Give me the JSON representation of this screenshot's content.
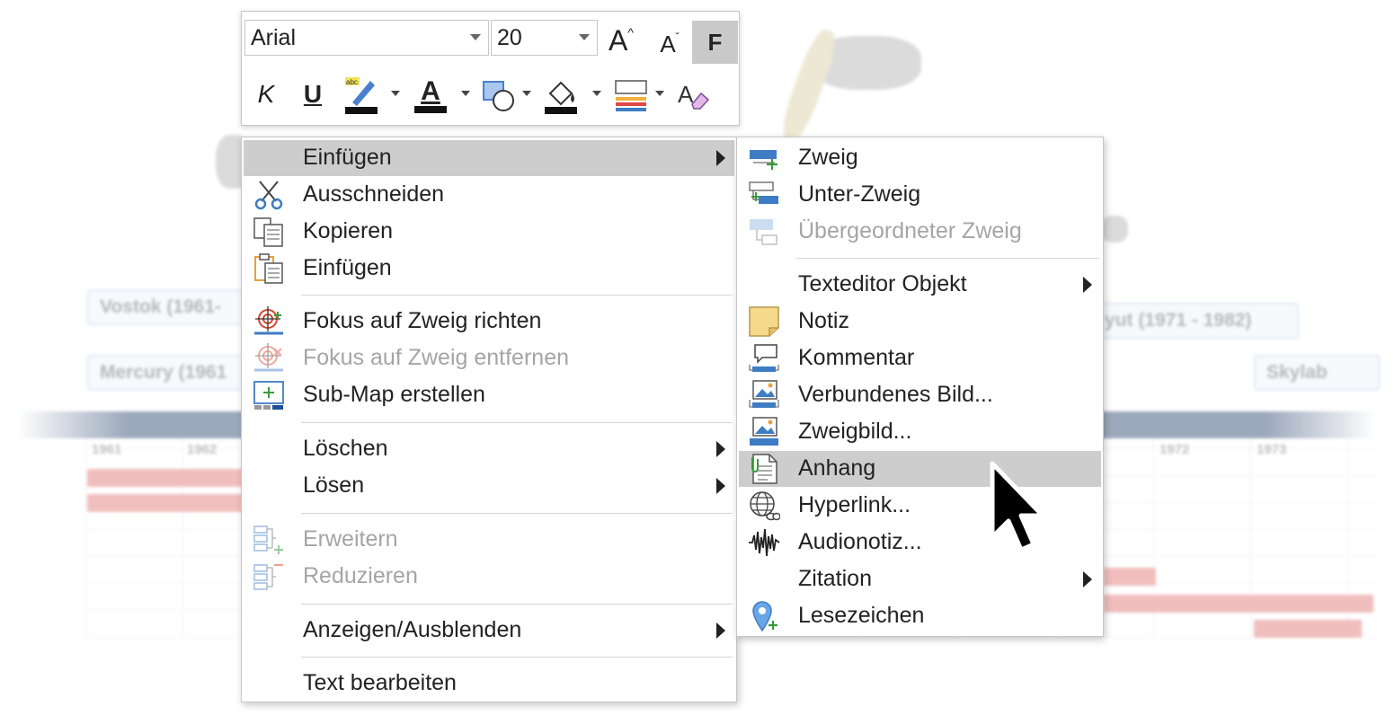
{
  "toolbar": {
    "font_name": "Arial",
    "font_size": "20",
    "grow_label": "A",
    "shrink_label": "A",
    "bold_label": "F",
    "italic_label": "K",
    "underline_label": "U",
    "font_color_label": "A",
    "clear_label": "A"
  },
  "context_menu": {
    "items": [
      {
        "label": "Einfügen",
        "icon": "none",
        "submenu": true,
        "highlighted": true,
        "disabled": false
      },
      {
        "label": "Ausschneiden",
        "icon": "scissors-icon",
        "submenu": false,
        "disabled": false
      },
      {
        "label": "Kopieren",
        "icon": "copy-icon",
        "submenu": false,
        "disabled": false
      },
      {
        "label": "Einfügen",
        "icon": "paste-icon",
        "submenu": false,
        "disabled": false
      },
      {
        "label": "Fokus auf Zweig richten",
        "icon": "focus-target-icon",
        "submenu": false,
        "disabled": false
      },
      {
        "label": "Fokus auf Zweig entfernen",
        "icon": "focus-remove-icon",
        "submenu": false,
        "disabled": true
      },
      {
        "label": "Sub-Map erstellen",
        "icon": "submap-icon",
        "submenu": false,
        "disabled": false
      },
      {
        "label": "Löschen",
        "icon": "none",
        "submenu": true,
        "disabled": false
      },
      {
        "label": "Lösen",
        "icon": "none",
        "submenu": true,
        "disabled": false
      },
      {
        "label": "Erweitern",
        "icon": "expand-icon",
        "submenu": false,
        "disabled": true
      },
      {
        "label": "Reduzieren",
        "icon": "collapse-icon",
        "submenu": false,
        "disabled": true
      },
      {
        "label": "Anzeigen/Ausblenden",
        "icon": "none",
        "submenu": true,
        "disabled": false
      },
      {
        "label": "Text bearbeiten",
        "icon": "none",
        "submenu": false,
        "disabled": false
      }
    ]
  },
  "submenu": {
    "items": [
      {
        "label": "Zweig",
        "icon": "branch-icon",
        "disabled": false
      },
      {
        "label": "Unter-Zweig",
        "icon": "subbranch-icon",
        "disabled": false
      },
      {
        "label": "Übergeordneter Zweig",
        "icon": "parent-branch-icon",
        "disabled": true
      },
      {
        "label": "Texteditor Objekt",
        "icon": "none",
        "submenu": true,
        "disabled": false
      },
      {
        "label": "Notiz",
        "icon": "note-icon",
        "disabled": false
      },
      {
        "label": "Kommentar",
        "icon": "comment-icon",
        "disabled": false
      },
      {
        "label": "Verbundenes Bild...",
        "icon": "linked-image-icon",
        "disabled": false
      },
      {
        "label": "Zweigbild...",
        "icon": "branch-image-icon",
        "disabled": false
      },
      {
        "label": "Anhang",
        "icon": "attachment-icon",
        "highlighted": true,
        "disabled": false
      },
      {
        "label": "Hyperlink...",
        "icon": "hyperlink-icon",
        "disabled": false
      },
      {
        "label": "Audionotiz...",
        "icon": "audio-icon",
        "disabled": false
      },
      {
        "label": "Zitation",
        "icon": "none",
        "submenu": true,
        "disabled": false
      },
      {
        "label": "Lesezeichen",
        "icon": "bookmark-icon",
        "disabled": false
      }
    ]
  },
  "background": {
    "boxes": [
      "Vostok (1961-",
      "Mercury (1961",
      "yut (1971 - 1982)",
      "Skylab"
    ],
    "years": [
      "1961",
      "1962",
      "1972",
      "1973"
    ],
    "timeline_color": "#4d6387",
    "bar_color": "#e78a8a"
  },
  "colors": {
    "highlight": "#cdcdcd",
    "disabled_text": "#a5a5a5",
    "accent_blue": "#3e7cc4"
  }
}
